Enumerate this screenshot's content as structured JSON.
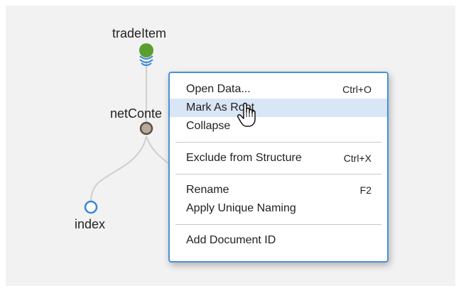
{
  "tree": {
    "nodes": {
      "root": {
        "label": "tradeItem",
        "color": "#5a9e2f"
      },
      "middle": {
        "label": "netConte",
        "color": "#b8a99a"
      },
      "leaf": {
        "label": "index",
        "color": "#3a86d6"
      }
    }
  },
  "context_menu": {
    "groups": [
      [
        {
          "label": "Open Data...",
          "shortcut": "Ctrl+O",
          "hovered": false
        },
        {
          "label": "Mark As Root",
          "shortcut": "",
          "hovered": true
        },
        {
          "label": "Collapse",
          "shortcut": "",
          "hovered": false
        }
      ],
      [
        {
          "label": "Exclude from Structure",
          "shortcut": "Ctrl+X",
          "hovered": false
        }
      ],
      [
        {
          "label": "Rename",
          "shortcut": "F2",
          "hovered": false
        },
        {
          "label": "Apply Unique Naming",
          "shortcut": "",
          "hovered": false
        }
      ],
      [
        {
          "label": "Add Document ID",
          "shortcut": "",
          "hovered": false
        }
      ]
    ]
  },
  "colors": {
    "accent": "#4a90d9",
    "hover": "#d9e6f5",
    "edge": "#cfcfcf"
  },
  "cursor": "hand-pointer-icon"
}
